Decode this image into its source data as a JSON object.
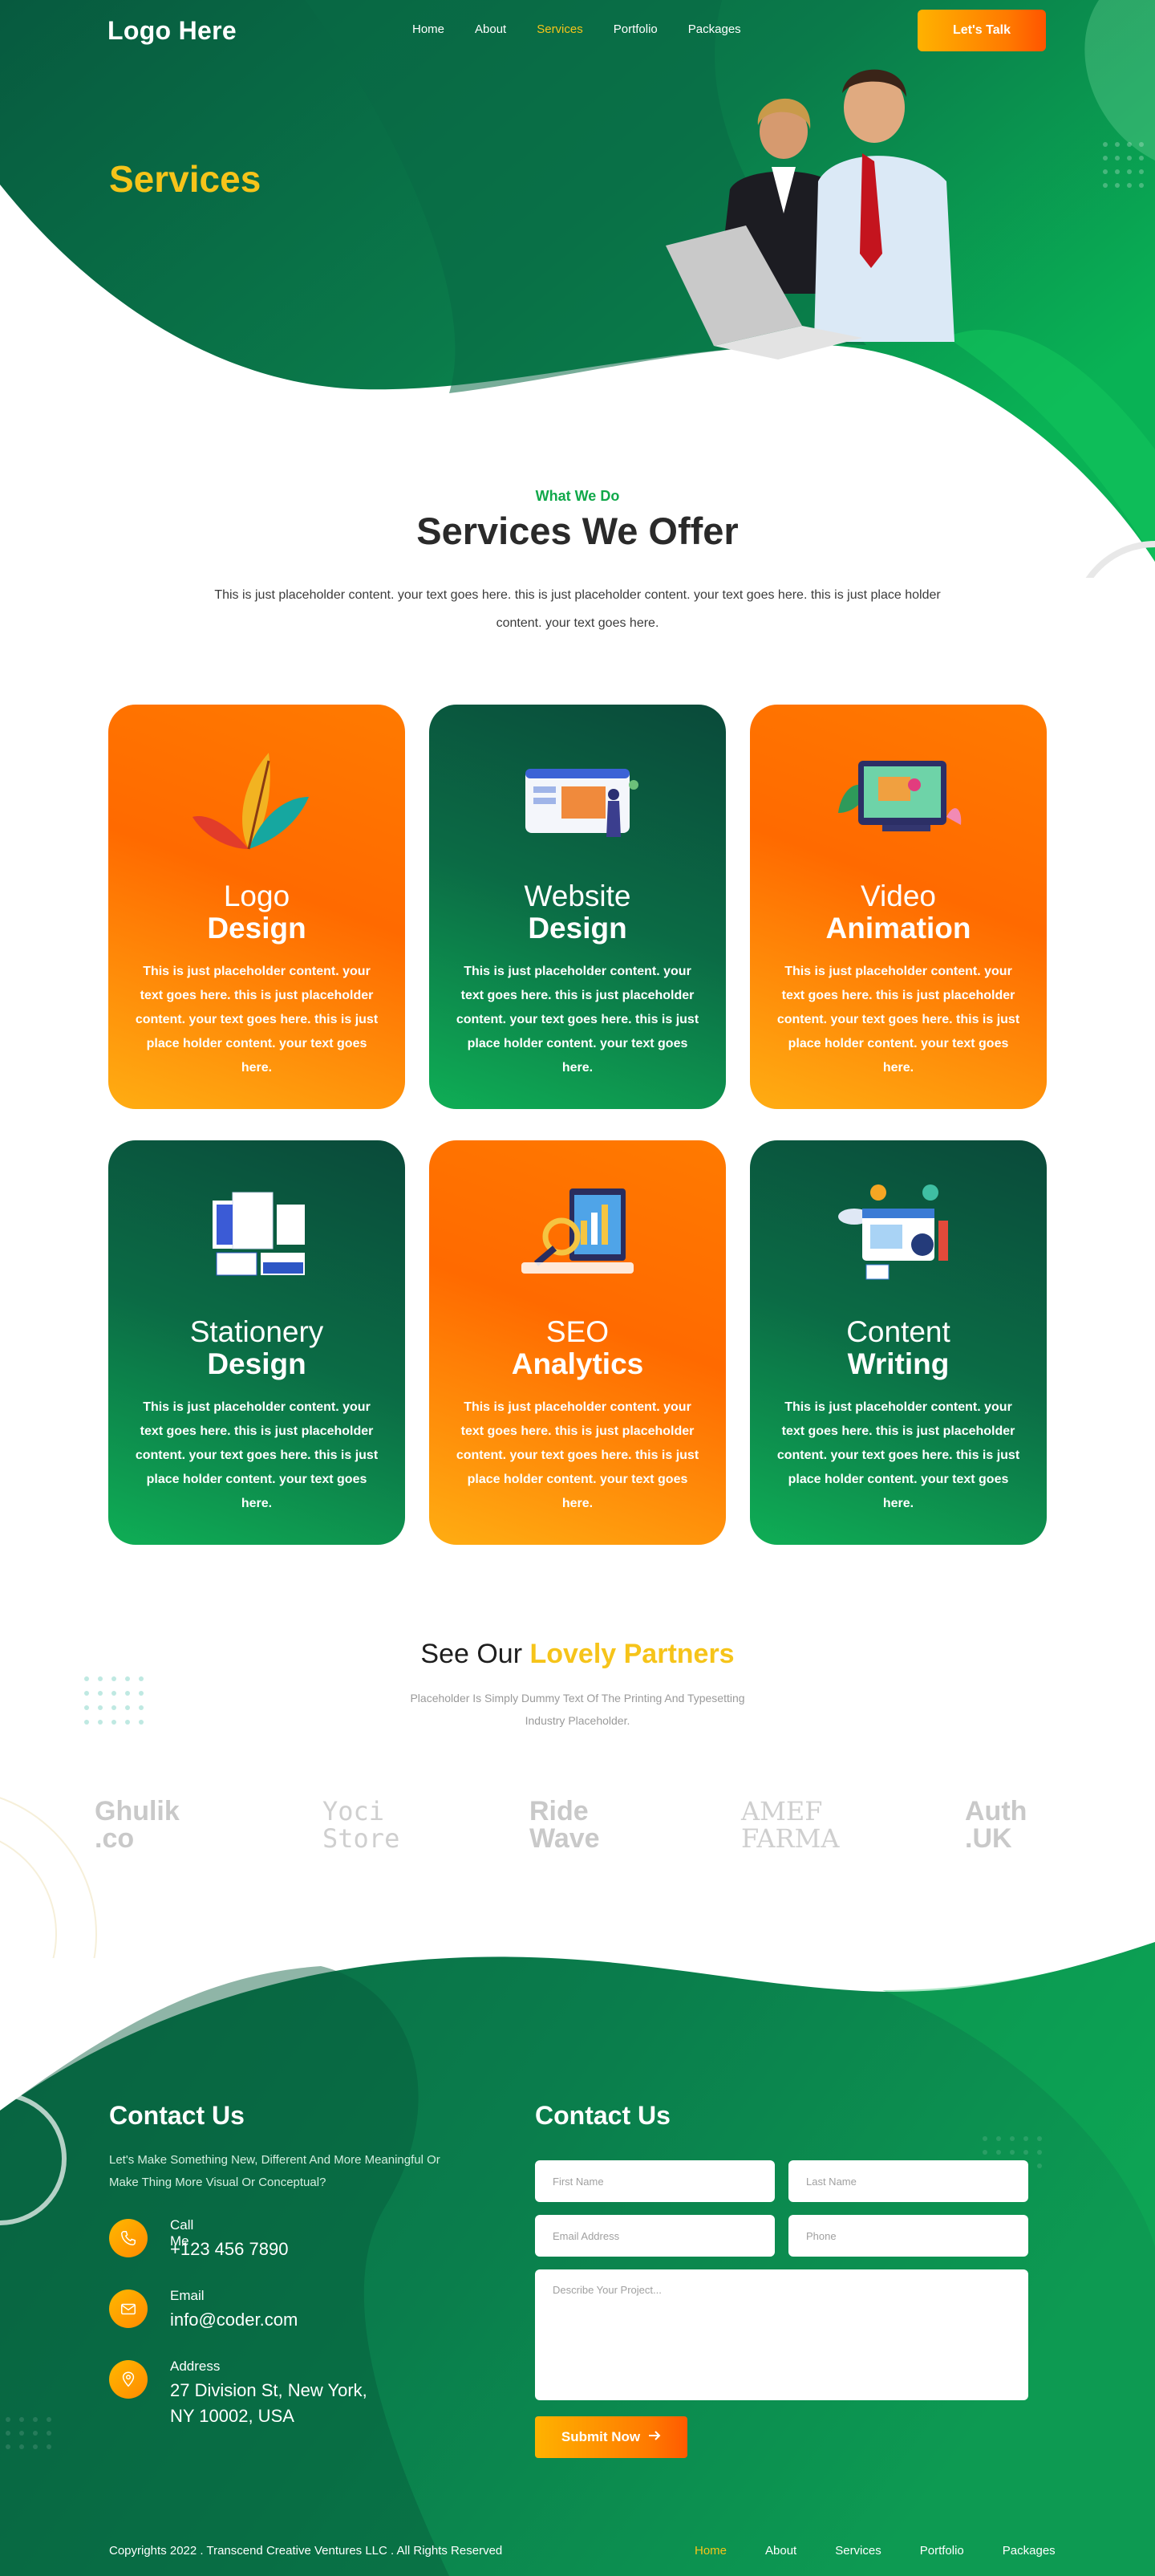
{
  "nav": {
    "logo": "Logo Here",
    "items": [
      {
        "label": "Home",
        "active": false
      },
      {
        "label": "About",
        "active": false
      },
      {
        "label": "Services",
        "active": true
      },
      {
        "label": "Portfolio",
        "active": false
      },
      {
        "label": "Packages",
        "active": false
      }
    ],
    "cta": "Let's Talk"
  },
  "hero": {
    "title": "Services"
  },
  "services": {
    "eyebrow": "What We Do",
    "title": "Services We Offer",
    "text": "This is just placeholder content. your text goes here. this is just placeholder content. your text goes here. this is just place holder content. your text goes here.",
    "cards": [
      {
        "line1": "Logo",
        "line2": "Design",
        "style": "orange",
        "icon": "feather-icon",
        "desc": "This is just placeholder content. your text goes here. this is just placeholder content. your text goes here. this is just place holder content. your text goes here."
      },
      {
        "line1": "Website",
        "line2": "Design",
        "style": "green",
        "icon": "website-design-icon",
        "desc": "This is just placeholder content. your text goes here. this is just placeholder content. your text goes here. this is just place holder content. your text goes here."
      },
      {
        "line1": "Video",
        "line2": "Animation",
        "style": "orange",
        "icon": "video-animation-icon",
        "desc": "This is just placeholder content. your text goes here. this is just placeholder content. your text goes here. this is just place holder content. your text goes here."
      },
      {
        "line1": "Stationery",
        "line2": "Design",
        "style": "green",
        "icon": "stationery-icon",
        "desc": "This is just placeholder content. your text goes here. this is just placeholder content. your text goes here. this is just place holder content. your text goes here."
      },
      {
        "line1": "SEO",
        "line2": "Analytics",
        "style": "orange",
        "icon": "seo-analytics-icon",
        "desc": "This is just placeholder content. your text goes here. this is just placeholder content. your text goes here. this is just place holder content. your text goes here."
      },
      {
        "line1": "Content",
        "line2": "Writing",
        "style": "green",
        "icon": "content-writing-icon",
        "desc": "This is just placeholder content. your text goes here. this is just placeholder content. your text goes here. this is just place holder content. your text goes here."
      }
    ]
  },
  "partners": {
    "title_plain": "See Our",
    "title_highlight": "Lovely Partners",
    "subtitle": "Placeholder Is Simply Dummy Text Of The Printing And Typesetting Industry Placeholder.",
    "logos": [
      {
        "l1": "Ghulik",
        "l2": ".co"
      },
      {
        "l1": "Yoci",
        "l2": "Store"
      },
      {
        "l1": "Ride",
        "l2": "Wave"
      },
      {
        "l1": "AMEF",
        "l2": "FARMA"
      },
      {
        "l1": "Auth",
        "l2": ".UK"
      }
    ]
  },
  "contact": {
    "left_title": "Contact Us",
    "lead": "Let's Make Something New, Different And More Meaningful Or Make Thing More Visual Or Conceptual?",
    "call_label": "Call Me",
    "call_value": "+123 456 7890",
    "email_label": "Email",
    "email_value": "info@coder.com",
    "address_label": "Address",
    "address_line1": "27 Division St, New York,",
    "address_line2": "NY 10002, USA",
    "form_title": "Contact Us",
    "first_name_ph": "First Name",
    "last_name_ph": "Last Name",
    "email_ph": "Email Address",
    "phone_ph": "Phone",
    "project_ph": "Describe Your Project...",
    "submit": "Submit Now"
  },
  "footer": {
    "copyright": "Copyrights 2022 . Transcend Creative Ventures LLC . All Rights Reserved",
    "menu": [
      {
        "label": "Home",
        "active": true
      },
      {
        "label": "About",
        "active": false
      },
      {
        "label": "Services",
        "active": false
      },
      {
        "label": "Portfolio",
        "active": false
      },
      {
        "label": "Packages",
        "active": false
      }
    ]
  },
  "colors": {
    "brand_green": "#0b6b45",
    "accent_yellow": "#f6c41a",
    "accent_orange": "#ff7a00"
  }
}
